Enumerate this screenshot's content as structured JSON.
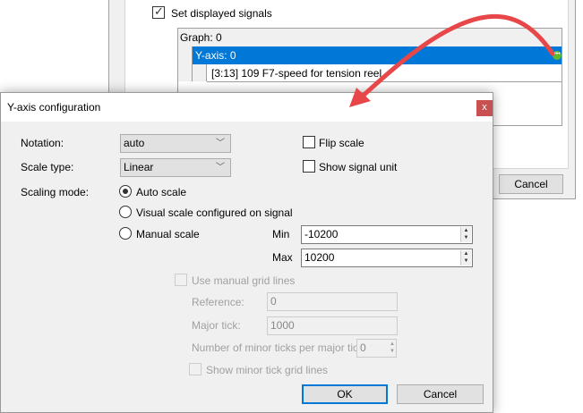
{
  "background_window": {
    "set_displayed_signals_label": "Set displayed signals",
    "set_displayed_signals_checked": true,
    "tree": {
      "graph": "Graph: 0",
      "y_axis": "Y-axis: 0",
      "signal": "[3:13] 109 F7-speed for tension reel"
    },
    "cancel_label": "Cancel"
  },
  "dialog": {
    "title": "Y-axis configuration",
    "close_label": "x",
    "notation_label": "Notation:",
    "notation_value": "auto",
    "scale_type_label": "Scale type:",
    "scale_type_value": "Linear",
    "flip_scale_label": "Flip scale",
    "show_signal_unit_label": "Show signal unit",
    "scaling_mode_label": "Scaling mode:",
    "scaling_options": [
      "Auto scale",
      "Visual scale configured on signal",
      "Manual scale"
    ],
    "scaling_selected": "Auto scale",
    "min_label": "Min",
    "min_value": "-10200",
    "max_label": "Max",
    "max_value": "10200",
    "use_manual_grid_label": "Use manual grid lines",
    "reference_label": "Reference:",
    "reference_value": "0",
    "major_tick_label": "Major tick:",
    "major_tick_value": "1000",
    "minor_ticks_label": "Number of minor ticks per major tick:",
    "minor_ticks_value": "0",
    "show_minor_grid_label": "Show minor tick grid lines",
    "ok_label": "OK",
    "cancel_label": "Cancel"
  },
  "colors": {
    "selection": "#0078d7",
    "close": "#c75050",
    "arrow": "#e8474a"
  }
}
